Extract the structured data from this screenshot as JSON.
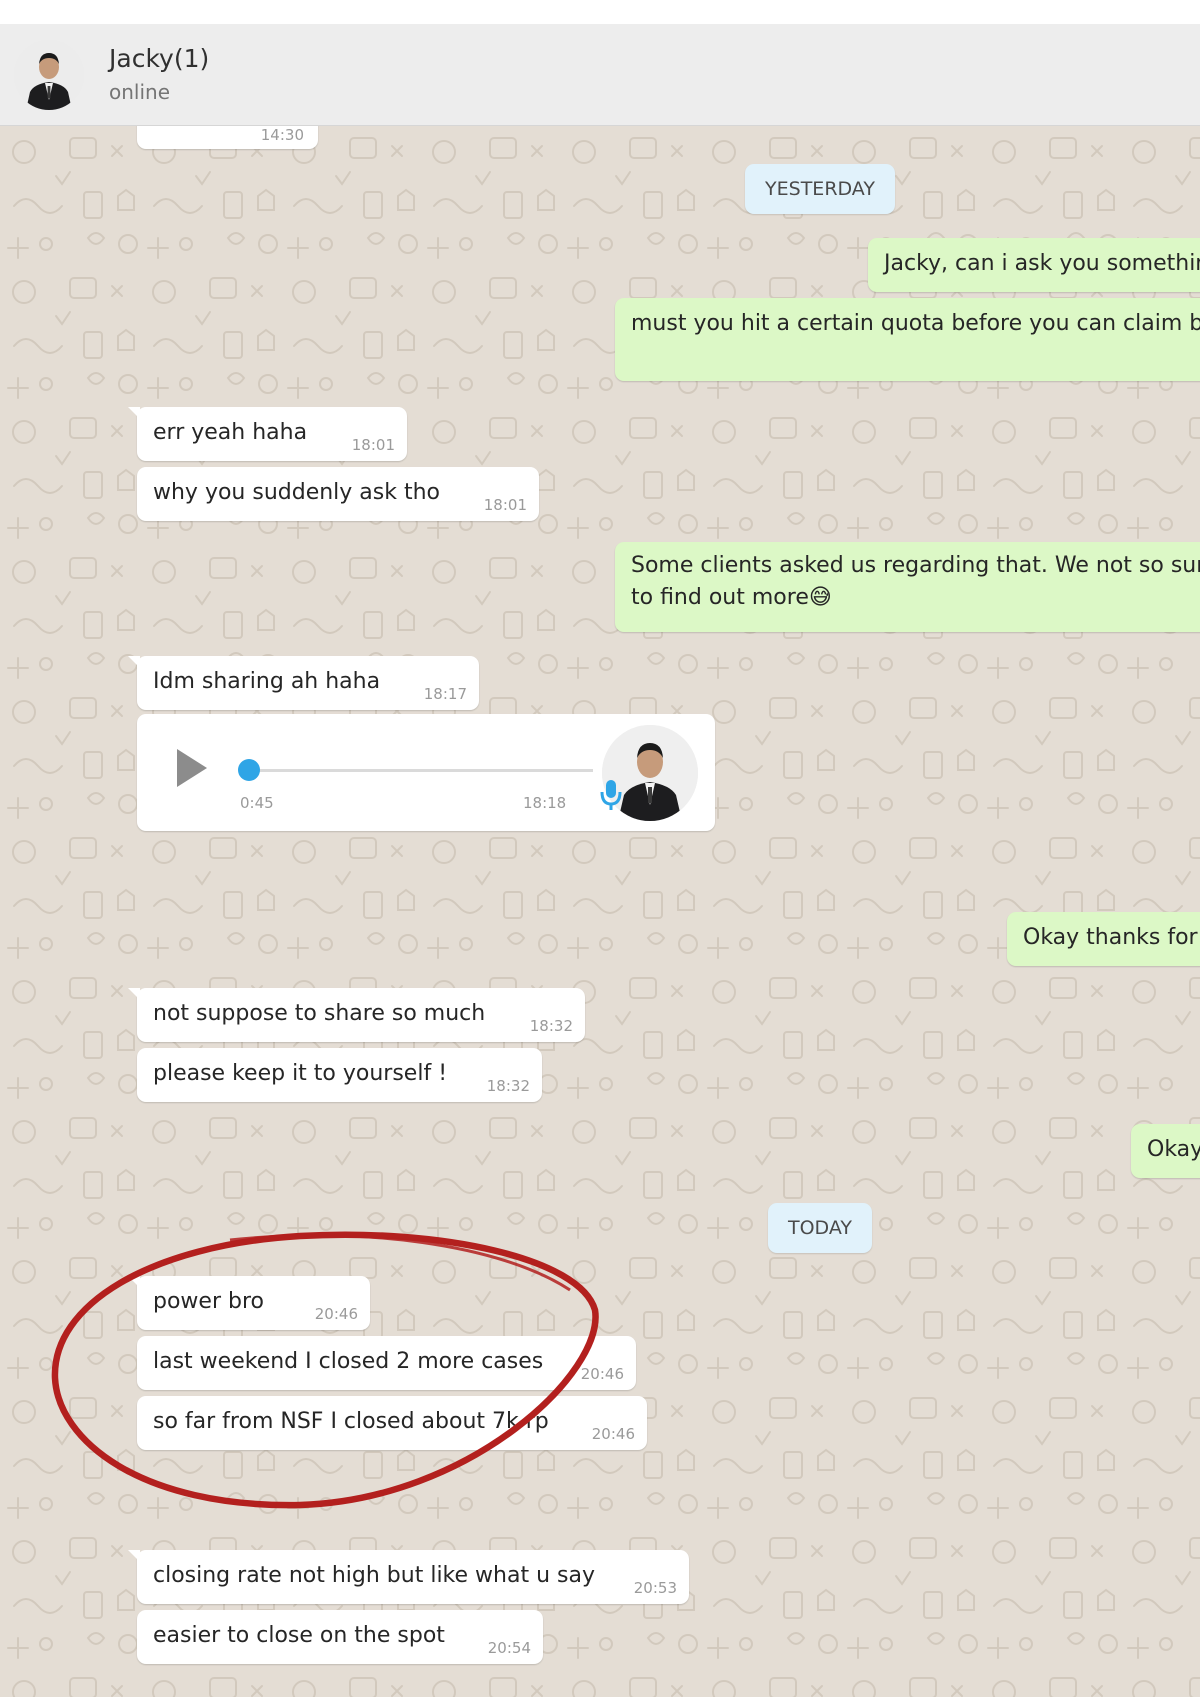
{
  "header": {
    "contact_name": "Jacky(1)",
    "status": "online"
  },
  "partial_top_time": "14:30",
  "date_chips": {
    "yesterday": "YESTERDAY",
    "today": "TODAY"
  },
  "messages": [
    {
      "dir": "out",
      "text": "Jacky, can i ask you something"
    },
    {
      "dir": "out",
      "text": "must you hit a certain quota before you can claim bac"
    },
    {
      "dir": "in",
      "text": "err yeah haha",
      "time": "18:01"
    },
    {
      "dir": "in",
      "text": "why you suddenly ask tho",
      "time": "18:01"
    },
    {
      "dir": "out",
      "line1": "Some clients asked us regarding that. We not so sure",
      "line2": "to find out more😅"
    },
    {
      "dir": "in",
      "text": "Idm sharing ah haha",
      "time": "18:17"
    },
    {
      "dir": "out",
      "text": "Okay thanks for t"
    },
    {
      "dir": "in",
      "text": "not suppose to share so much",
      "time": "18:32"
    },
    {
      "dir": "in",
      "text": "please keep it to yourself !",
      "time": "18:32"
    },
    {
      "dir": "out",
      "text": "Okay"
    },
    {
      "dir": "in",
      "text": "power bro",
      "time": "20:46"
    },
    {
      "dir": "in",
      "text": "last weekend I closed 2 more cases",
      "time": "20:46"
    },
    {
      "dir": "in",
      "text": "so far from NSF I closed about 7k rp",
      "time": "20:46"
    },
    {
      "dir": "in",
      "text": "closing rate not high but like what u say",
      "time": "20:53"
    },
    {
      "dir": "in",
      "text": "easier to close on the spot",
      "time": "20:54"
    }
  ],
  "voice_note": {
    "duration": "0:45",
    "time": "18:18",
    "progress": 0
  },
  "colors": {
    "chat_background": "#e4ddd4",
    "incoming_bubble": "#ffffff",
    "outgoing_bubble": "#dcf8c6",
    "date_chip": "#e1f2fb",
    "accent_blue": "#2fa5e6",
    "annotation_red": "#b3201e"
  }
}
